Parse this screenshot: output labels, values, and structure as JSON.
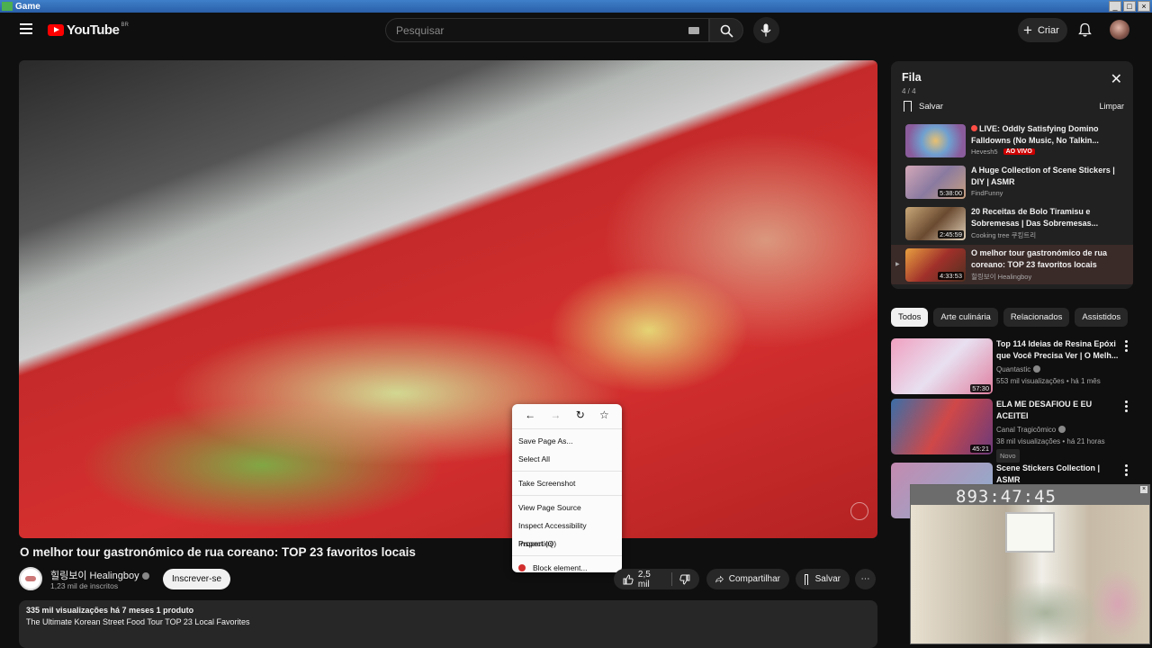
{
  "window": {
    "title": "Game",
    "controls": [
      "_",
      "□",
      "×"
    ]
  },
  "header": {
    "logo_text": "YouTube",
    "region": "BR",
    "search": {
      "placeholder": "Pesquisar",
      "value": ""
    },
    "create_label": "Criar"
  },
  "video": {
    "title": "O melhor tour gastronómico de rua coreano: TOP 23 favoritos locais",
    "channel": "힐링보이 Healingboy",
    "subscribers": "1,23 mil de inscritos",
    "subscribe_label": "Inscrever-se",
    "likes": "2,5 mil",
    "share_label": "Compartilhar",
    "save_label": "Salvar",
    "views_meta": "335 mil visualizações  há 7 meses  1 produto",
    "description": "The Ultimate Korean Street Food Tour TOP 23 Local Favorites"
  },
  "context_menu": {
    "items": [
      "Save Page As...",
      "Select All",
      "Take Screenshot",
      "View Page Source",
      "Inspect Accessibility Properties",
      "Inspect (Q)",
      "Block element..."
    ]
  },
  "queue": {
    "title": "Fila",
    "position": "4 / 4",
    "save_label": "Salvar",
    "clear_label": "Limpar",
    "items": [
      {
        "title": "LIVE: Oddly Satisfying Domino Falldowns (No Music, No Talkin...",
        "channel": "Hevesh5",
        "badge": "AO VIVO",
        "duration": "",
        "thumb": "#7a5c8c"
      },
      {
        "title": "A Huge Collection of Scene Stickers | DIY | ASMR",
        "channel": "FindFunny",
        "duration": "5:38:00",
        "thumb": "#b58a9a"
      },
      {
        "title": "20 Receitas de Bolo Tiramisu e Sobremesas | Das Sobremesas...",
        "channel": "Cooking tree 쿠킹트리",
        "duration": "2:45:59",
        "thumb": "#8a6a4a"
      },
      {
        "title": "O melhor tour gastronómico de rua coreano: TOP 23 favoritos locais",
        "channel": "힐링보이 Healingboy",
        "duration": "4:33:53",
        "thumb": "#a0452a"
      }
    ]
  },
  "chips": [
    "Todos",
    "Arte culinária",
    "Relacionados",
    "Assistidos"
  ],
  "recommendations": [
    {
      "title": "Top 114 Ideias de Resina Epóxi que Você Precisa Ver | O Melh...",
      "channel": "Quantastic",
      "meta": "553 mil visualizações • há 1 mês",
      "duration": "57:30",
      "badge": "",
      "thumb": "#e07fa0"
    },
    {
      "title": "ELA ME DESAFIOU E EU ACEITEI",
      "channel": "Canal Tragicômico",
      "meta": "38 mil visualizações • há 21 horas",
      "duration": "45:21",
      "badge": "Novo",
      "thumb": "#3a6ea8"
    },
    {
      "title": "Scene Stickers Collection | ASMR",
      "channel": "",
      "meta": "",
      "duration": "",
      "badge": "",
      "thumb": "#c48ab0"
    }
  ],
  "webcam": {
    "clock": "893:47:45"
  }
}
